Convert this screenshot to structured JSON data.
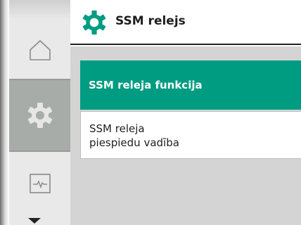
{
  "header": {
    "title": "SSM relejs",
    "icon": "gear-icon",
    "icon_color": "#009c82"
  },
  "sidebar": {
    "items": [
      {
        "name": "home",
        "icon": "home-icon",
        "active": false
      },
      {
        "name": "settings",
        "icon": "gear-icon",
        "active": true
      },
      {
        "name": "diagnostics",
        "icon": "monitor-icon",
        "active": false
      }
    ],
    "more_indicator": "chevron-down-icon"
  },
  "menu": {
    "items": [
      {
        "line1": "SSM releja funkcija",
        "line2": "",
        "selected": true
      },
      {
        "line1": "SSM releja",
        "line2": "piespiedu vadība",
        "selected": false
      }
    ]
  },
  "colors": {
    "accent": "#009c82",
    "content_bg": "#d4d4d4",
    "sidebar_active": "#a7aca8"
  }
}
